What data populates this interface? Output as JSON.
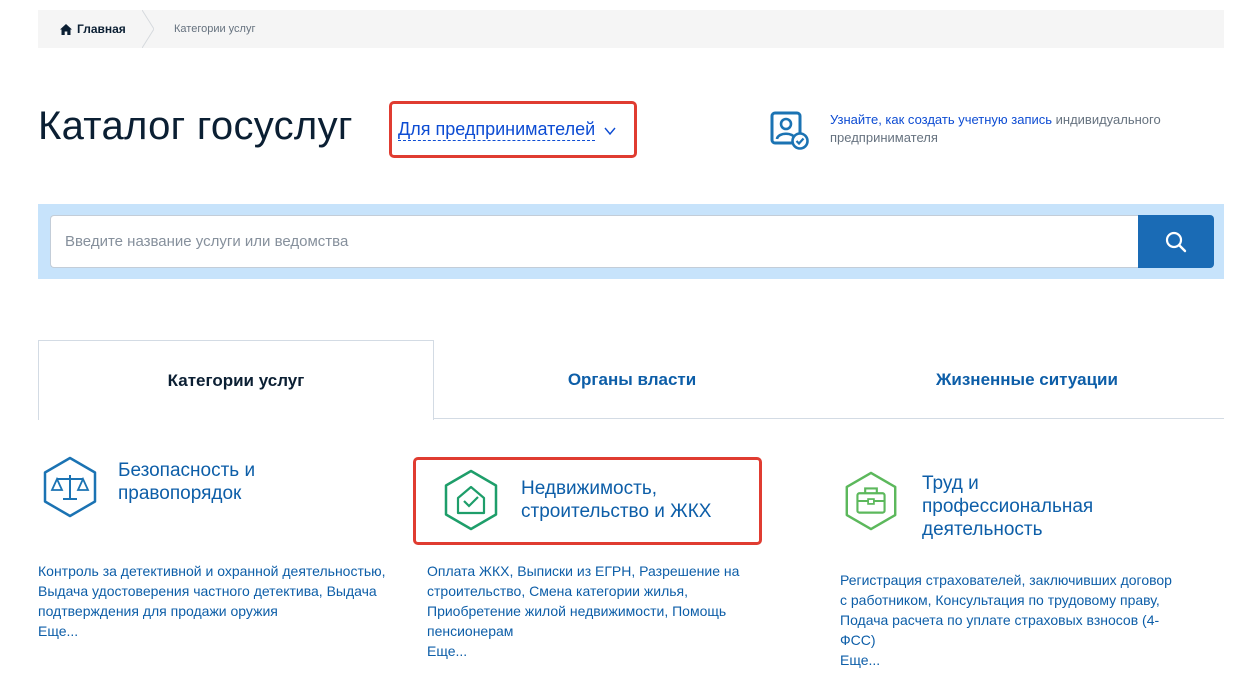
{
  "breadcrumb": {
    "home": "Главная",
    "current": "Категории услуг"
  },
  "header": {
    "title": "Каталог госуслуг",
    "audience_selector": "Для предпринимателей",
    "account_link": "Узнайте, как создать учетную запись",
    "account_rest": " индивидуального предпринимателя"
  },
  "search": {
    "placeholder": "Введите название услуги или ведомства"
  },
  "tabs": [
    {
      "label": "Категории услуг",
      "active": true
    },
    {
      "label": "Органы власти",
      "active": false
    },
    {
      "label": "Жизненные ситуации",
      "active": false
    }
  ],
  "categories": [
    {
      "title": "Безопасность и правопорядок",
      "services": "Контроль за детективной и охранной деятельностью, Выдача удостоверения частного детектива, Выдача подтверждения для продажи оружия",
      "more": "Еще...",
      "icon": "scales-icon",
      "color": "#1b73b3"
    },
    {
      "title": "Недвижимость, строительство и ЖКХ",
      "services": "Оплата ЖКХ, Выписки из ЕГРН, Разрешение на строительство, Смена категории жилья, Приобретение жилой недвижимости, Помощь пенсионерам",
      "more": "Еще...",
      "icon": "house-icon",
      "color": "#1e9e6a"
    },
    {
      "title": "Труд и профессиональная деятельность",
      "services": "Регистрация страхователей, заключивших договор с работником, Консультация по трудовому праву, Подача расчета по уплате страховых взносов (4-ФСС)",
      "more": "Еще...",
      "icon": "briefcase-icon",
      "color": "#5cb85c"
    }
  ],
  "colors": {
    "highlight": "#e03c31",
    "link": "#0d5ea8",
    "search_button": "#1a6bb5",
    "search_band": "#c7e3fb"
  }
}
